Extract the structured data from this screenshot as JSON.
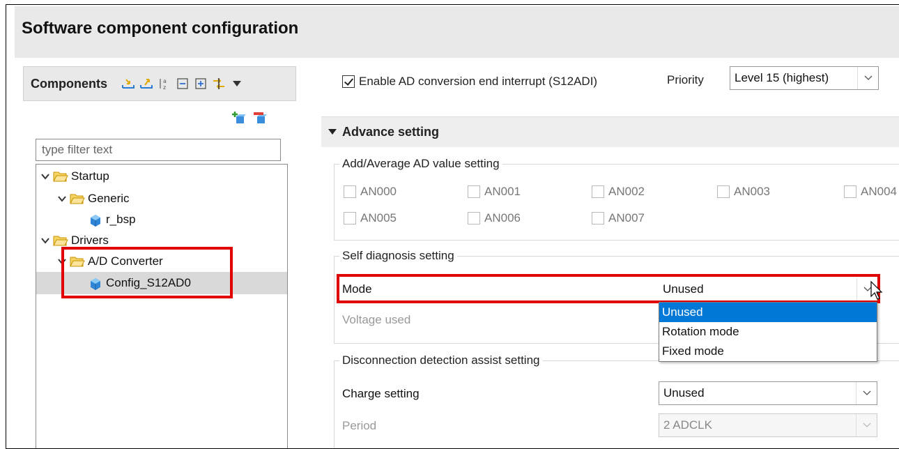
{
  "window": {
    "title": "Software component configuration"
  },
  "components": {
    "title": "Components",
    "toolbar_icons": [
      "import-icon",
      "export-icon",
      "sort-az-icon",
      "collapse-all-icon",
      "expand-all-icon",
      "sync-icon",
      "view-menu-icon"
    ],
    "add_icon": "add-component-icon",
    "remove_icon": "remove-component-icon",
    "filter_placeholder": "type filter text",
    "tree": [
      {
        "label": "Startup",
        "level": 0,
        "type": "folder"
      },
      {
        "label": "Generic",
        "level": 1,
        "type": "folder"
      },
      {
        "label": "r_bsp",
        "level": 2,
        "type": "component"
      },
      {
        "label": "Drivers",
        "level": 0,
        "type": "folder"
      },
      {
        "label": "A/D Converter",
        "level": 1,
        "type": "folder"
      },
      {
        "label": "Config_S12AD0",
        "level": 2,
        "type": "component",
        "selected": true
      }
    ]
  },
  "interrupt": {
    "checkbox_label": "Enable AD conversion end interrupt (S12ADI)",
    "checked": true,
    "priority_label": "Priority",
    "priority_value": "Level 15 (highest)"
  },
  "advance": {
    "title": "Advance setting",
    "add_avg_group": "Add/Average AD value setting",
    "channels": [
      "AN000",
      "AN001",
      "AN002",
      "AN003",
      "AN004",
      "AN005",
      "AN006",
      "AN007"
    ],
    "self_diag_group": "Self diagnosis setting",
    "mode_label": "Mode",
    "mode_value": "Unused",
    "mode_options": [
      "Unused",
      "Rotation mode",
      "Fixed mode"
    ],
    "voltage_label": "Voltage used",
    "disconnect_group": "Disconnection detection assist setting",
    "charge_label": "Charge setting",
    "charge_value": "Unused",
    "period_label": "Period",
    "period_value": "2 ADCLK"
  },
  "colors": {
    "highlight_box": "#e00000",
    "selected_option": "#0078d7",
    "header_bg": "#e9e9e9"
  }
}
